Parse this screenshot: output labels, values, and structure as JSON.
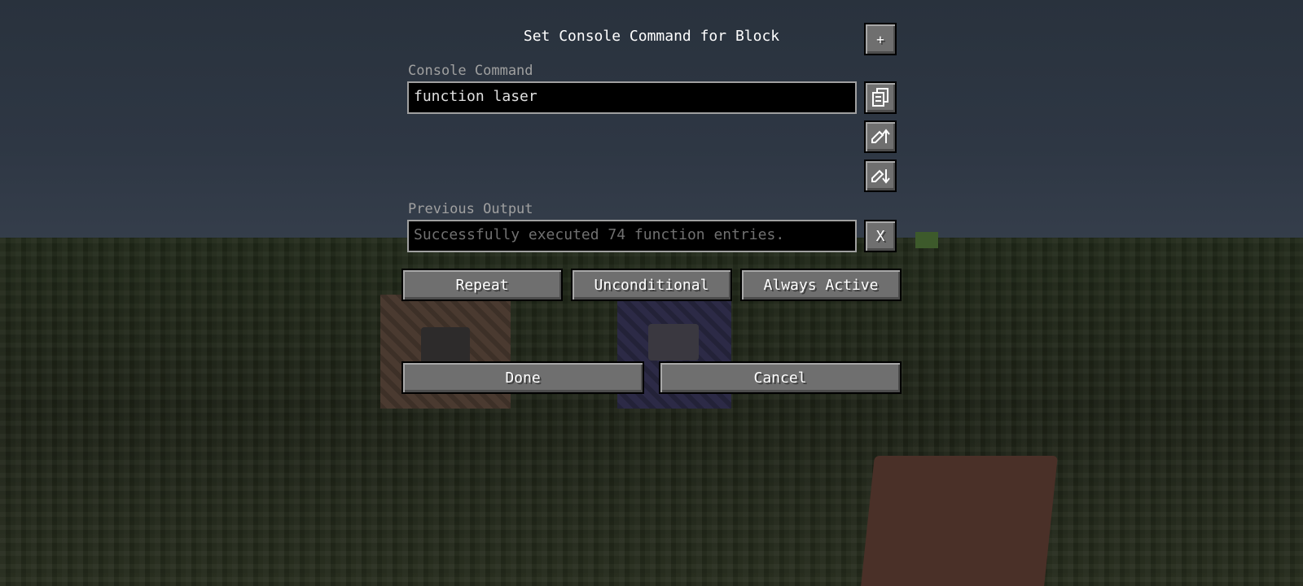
{
  "title": "Set Console Command for Block",
  "command": {
    "label": "Console Command",
    "value": "function laser"
  },
  "output": {
    "label": "Previous Output",
    "value": "Successfully executed 74 function entries."
  },
  "side_buttons": {
    "add": "+",
    "clear_output": "X",
    "icons": [
      "clipboard-icon",
      "edit-up-icon",
      "edit-down-icon"
    ]
  },
  "modes": {
    "type": "Repeat",
    "condition": "Unconditional",
    "redstone": "Always Active"
  },
  "actions": {
    "done": "Done",
    "cancel": "Cancel"
  },
  "colors": {
    "field_bg": "#000000",
    "field_border": "#a0a0a0",
    "button_bg": "#6f6f6f",
    "label": "#a0a0a0"
  }
}
